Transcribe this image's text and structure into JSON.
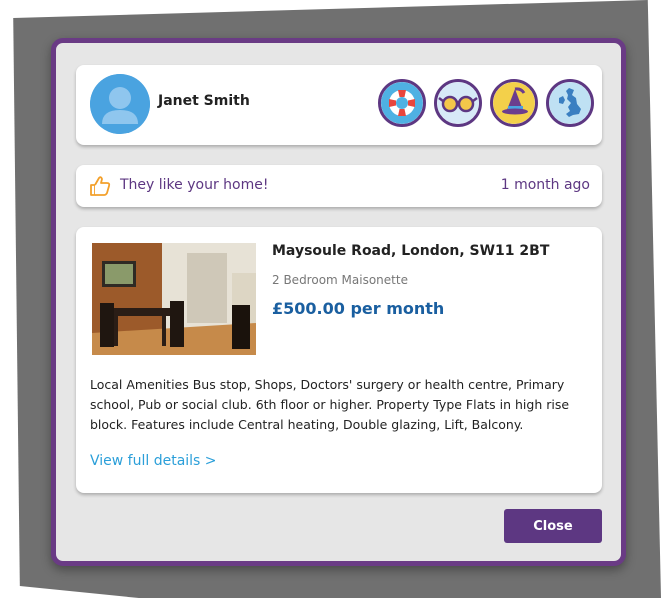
{
  "profile": {
    "name": "Janet Smith",
    "avatar_icon": "user-silhouette-icon",
    "badges": [
      {
        "icon": "lifebuoy-icon",
        "bg": "#4fb1e3"
      },
      {
        "icon": "glasses-icon",
        "bg": "#d7e9f7"
      },
      {
        "icon": "wizard-hat-icon",
        "bg": "#f3d04a"
      },
      {
        "icon": "uk-map-icon",
        "bg": "#bfe1f3"
      }
    ]
  },
  "notification": {
    "icon": "thumbs-up-icon",
    "text": "They like your home!",
    "time": "1 month ago"
  },
  "property": {
    "address": "Maysoule Road, London, SW11 2BT",
    "type": "2 Bedroom Maisonette",
    "price": "£500.00 per month",
    "description": "Local Amenities Bus stop, Shops, Doctors' surgery or health centre, Primary school, Pub or social club. 6th floor or higher. Property Type Flats in high rise block. Features include Central heating, Double glazing, Lift, Balcony.",
    "link_label": "View full details >"
  },
  "actions": {
    "close_label": "Close"
  },
  "colors": {
    "accent": "#5d3782",
    "price": "#1a5fa0",
    "link": "#2b9fd9"
  }
}
